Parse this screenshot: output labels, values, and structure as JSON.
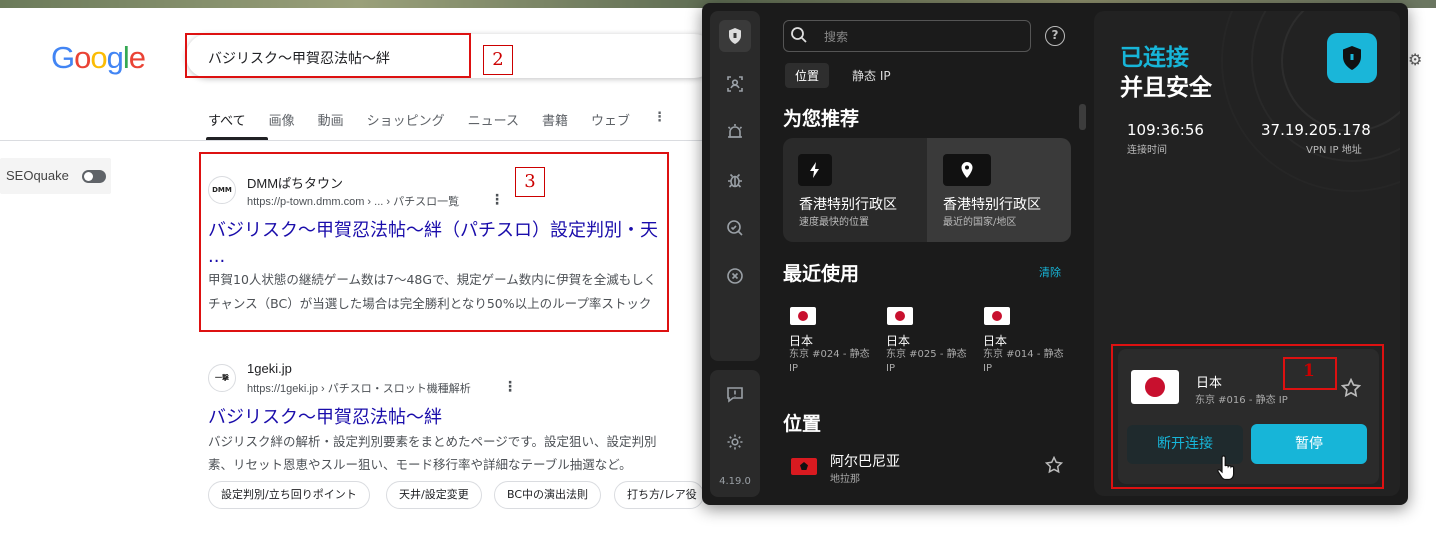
{
  "google": {
    "logo_letters": [
      "G",
      "o",
      "o",
      "g",
      "l",
      "e"
    ],
    "logo_colors": [
      "#4285F4",
      "#EA4335",
      "#FBBC05",
      "#4285F4",
      "#34A853",
      "#EA4335"
    ],
    "search_value": "バジリスク〜甲賀忍法帖〜絆",
    "annotation_search": "2",
    "annotation_result": "3",
    "tabs": [
      "すべて",
      "画像",
      "動画",
      "ショッピング",
      "ニュース",
      "書籍",
      "ウェブ"
    ],
    "seoquake_label": "SEOquake",
    "results": [
      {
        "site_name": "DMMぱちタウン",
        "url": "https://p-town.dmm.com › ... › パチスロ一覧",
        "favicon_text": "DMM",
        "title": "バジリスク〜甲賀忍法帖〜絆（パチスロ）設定判別・天",
        "title_cont": "...",
        "snippet": [
          "甲賀10人状態の継続ゲーム数は7〜48Gで、規定ゲーム数内に伊賀を全滅もしく",
          "チャンス（BC）が当選した場合は完全勝利となり50%以上のループ率ストック"
        ]
      },
      {
        "site_name": "1geki.jp",
        "url": "https://1geki.jp › パチスロ・スロット機種解析",
        "favicon_text": "一撃",
        "title": "バジリスク〜甲賀忍法帖〜絆",
        "snippet": [
          "バジリスク絆の解析・設定判別要素をまとめたページです。設定狙い、設定判別",
          "素、リセット恩恵やスルー狙い、モード移行率や詳細なテーブル抽選など。"
        ],
        "chips": [
          "設定判別/立ち回りポイント",
          "天井/設定変更",
          "BC中の演出法則",
          "打ち方/レア役"
        ]
      }
    ]
  },
  "vpn": {
    "search_placeholder": "搜索",
    "help": "?",
    "tabs": [
      "位置",
      "静态 IP"
    ],
    "recommend_title": "为您推荐",
    "recommend_cards": [
      {
        "title": "香港特别行政区",
        "sub": "速度最快的位置"
      },
      {
        "title": "香港特别行政区",
        "sub": "最近的国家/地区"
      }
    ],
    "recent_title": "最近使用",
    "clear": "清除",
    "recent": [
      {
        "name": "日本",
        "sub": "东京 #024 - 静态 IP"
      },
      {
        "name": "日本",
        "sub": "东京 #025 - 静态 IP"
      },
      {
        "name": "日本",
        "sub": "东京 #014 - 静态 IP"
      }
    ],
    "locations_title": "位置",
    "location_first": {
      "name": "阿尔巴尼亚",
      "sub": "地拉那"
    },
    "version": "4.19.0",
    "status_line1": "已连接",
    "status_line2": "并且安全",
    "connection_time": "109:36:56",
    "connection_time_label": "连接时间",
    "vpn_ip": "37.19.205.178",
    "vpn_ip_label": "VPN IP 地址",
    "current_country": "日本",
    "current_server": "东京 #016 - 静态 IP",
    "annotation_server": "1",
    "disconnect": "断开连接",
    "pause": "暂停",
    "accent_color": "#17b5d8"
  }
}
